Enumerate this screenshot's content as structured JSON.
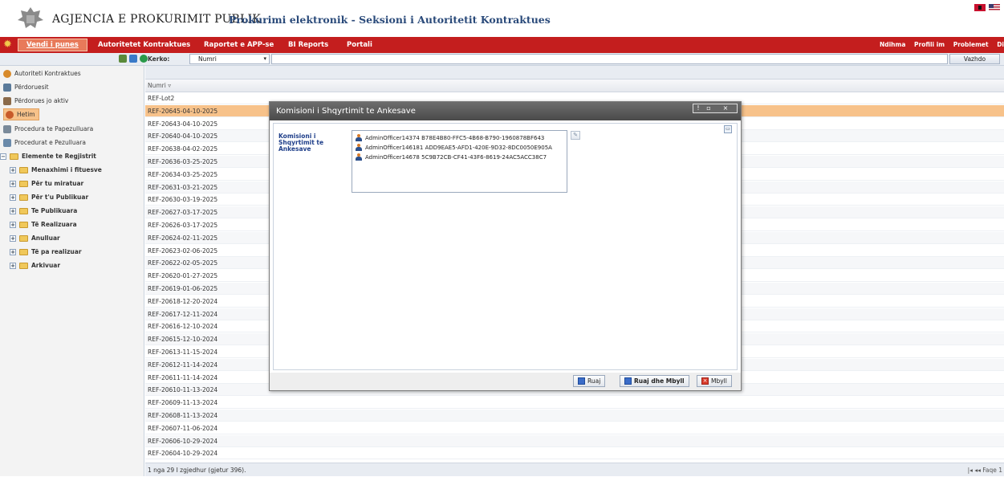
{
  "header": {
    "agency": "AGJENCIA E PROKURIMIT PUBLIK",
    "subtitle": "Prokurimi elektronik - Seksioni i Autoritetit Kontraktues"
  },
  "nav": {
    "items": [
      "Vendi i punes",
      "Autoritetet Kontraktues",
      "Raportet e APP-se",
      "BI Reports",
      "Portali"
    ],
    "right": [
      "Ndihma",
      "Profili im",
      "Problemet",
      "Di"
    ]
  },
  "search": {
    "label": "Kerko:",
    "field": "Numri",
    "button": "Vazhdo"
  },
  "sidebar": {
    "items": [
      "Autoriteti Kontraktues",
      "Përdoruesit",
      "Përdorues jo aktiv",
      "Hetim",
      "Procedura te Papezulluara",
      "Procedurat e Pezulluara",
      "Elemente te Regjistrit",
      "Menaxhimi i fituesve",
      "Për tu miratuar",
      "Për t'u Publikuar",
      "Te Publikuara",
      "Të Realizuara",
      "Anulluar",
      "Të pa realizuar",
      "Arkivuar"
    ]
  },
  "grid": {
    "column": "Numri",
    "rows": [
      "REF-Lot2",
      "REF-20645-04-10-2025",
      "REF-20643-04-10-2025",
      "REF-20640-04-10-2025",
      "REF-20638-04-02-2025",
      "REF-20636-03-25-2025",
      "REF-20634-03-25-2025",
      "REF-20631-03-21-2025",
      "REF-20630-03-19-2025",
      "REF-20627-03-17-2025",
      "REF-20626-03-17-2025",
      "REF-20624-02-11-2025",
      "REF-20623-02-06-2025",
      "REF-20622-02-05-2025",
      "REF-20620-01-27-2025",
      "REF-20619-01-06-2025",
      "REF-20618-12-20-2024",
      "REF-20617-12-11-2024",
      "REF-20616-12-10-2024",
      "REF-20615-12-10-2024",
      "REF-20613-11-15-2024",
      "REF-20612-11-14-2024",
      "REF-20611-11-14-2024",
      "REF-20610-11-13-2024",
      "REF-20609-11-13-2024",
      "REF-20608-11-13-2024",
      "REF-20607-11-06-2024",
      "REF-20606-10-29-2024",
      "REF-20604-10-29-2024"
    ],
    "selected_row": 1,
    "footer": "1 nga 29 I zgjedhur (gjetur 396).",
    "pager": "Faqe 1"
  },
  "dialog": {
    "title": "Komisioni i Shqyrtimit te Ankesave",
    "label": "Komisioni i Shqyrtimit te Ankesave",
    "members": [
      "AdminOfficer14374 B78E4B80-FFC5-4B68-B790-1960878BF643",
      "AdminOfficer146181 ADD9EAE5-AFD1-420E-9D32-8DC0050E905A",
      "AdminOfficer14678 5C9B72CB-CF41-43F6-8619-24AC5ACC38C7"
    ],
    "buttons": {
      "save": "Ruaj",
      "save_close": "Ruaj dhe Mbyll",
      "close": "Mbyll"
    }
  },
  "colors": {
    "nav_bg": "#c41e1e",
    "selected_row": "#f7c28a",
    "dialog_title_bg": "#5a5a5a",
    "label_blue": "#1f3f8a"
  }
}
